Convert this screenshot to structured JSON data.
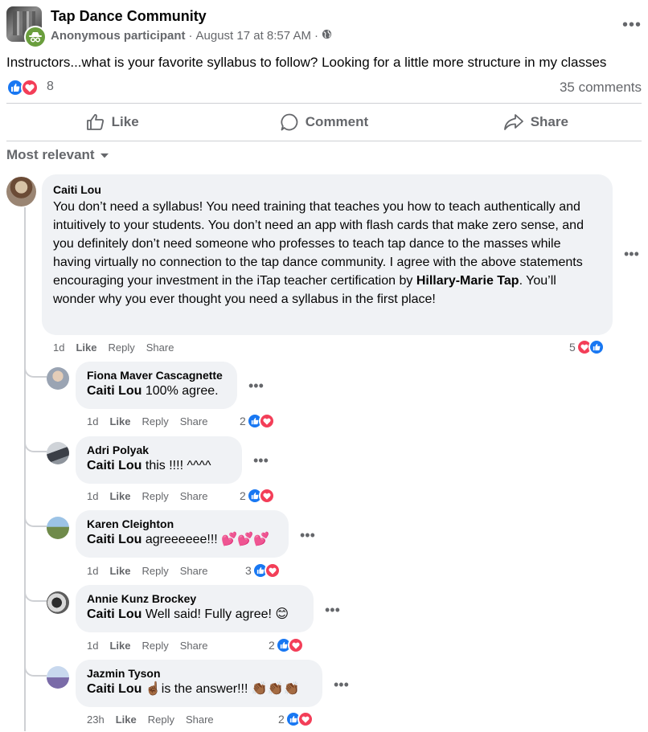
{
  "post": {
    "group_name": "Tap Dance Community",
    "author": "Anonymous participant",
    "date": "August 17 at 8:57 AM",
    "separator": "·",
    "text": "Instructors...what is your favorite syllabus to follow? Looking for a little more structure in my classes",
    "reaction_count": "8",
    "comments_count": "35 comments"
  },
  "actions": {
    "like": "Like",
    "comment": "Comment",
    "share": "Share"
  },
  "sort_label": "Most relevant",
  "comments": [
    {
      "name": "Caiti Lou",
      "text_part1": "You don’t need a syllabus! You need training that teaches you how to teach authentically and intuitively to your students. You don’t need an app with flash cards that make zero sense, and you definitely don’t need someone who professes to teach tap dance to the masses while having virtually no connection to the tap dance community. I agree with the above statements encouraging your investment in the iTap teacher certification by ",
      "mention": "Hillary-Marie Tap",
      "text_part2": ". You’ll wonder why you ever thought you need a syllabus in the first place!",
      "time": "1d",
      "like": "Like",
      "reply": "Reply",
      "share": "Share",
      "reactions": "5"
    }
  ],
  "replies": [
    {
      "name": "Fiona Maver Cascagnette",
      "mention": "Caiti Lou",
      "text": " 100% agree.",
      "time": "1d",
      "like": "Like",
      "reply": "Reply",
      "share": "Share",
      "reactions": "2"
    },
    {
      "name": "Adri Polyak",
      "mention": "Caiti Lou",
      "text": " this !!!! ^^^^",
      "time": "1d",
      "like": "Like",
      "reply": "Reply",
      "share": "Share",
      "reactions": "2"
    },
    {
      "name": "Karen Cleighton",
      "mention": "Caiti Lou",
      "text": " agreeeeee!!! 💕💕💕",
      "time": "1d",
      "like": "Like",
      "reply": "Reply",
      "share": "Share",
      "reactions": "3"
    },
    {
      "name": "Annie Kunz Brockey",
      "mention": "Caiti Lou",
      "text": " Well said! Fully agree! 😊",
      "time": "1d",
      "like": "Like",
      "reply": "Reply",
      "share": "Share",
      "reactions": "2"
    },
    {
      "name": "Jazmin Tyson",
      "mention": "Caiti Lou",
      "text": " ☝🏾is the answer!!! 👏🏾👏🏾👏🏾",
      "time": "23h",
      "like": "Like",
      "reply": "Reply",
      "share": "Share",
      "reactions": "2"
    }
  ],
  "colors": {
    "like_blue": "#1877f2",
    "love_red": "#f33e58",
    "secondary_text": "#65676b",
    "bubble_bg": "#f0f2f5"
  }
}
